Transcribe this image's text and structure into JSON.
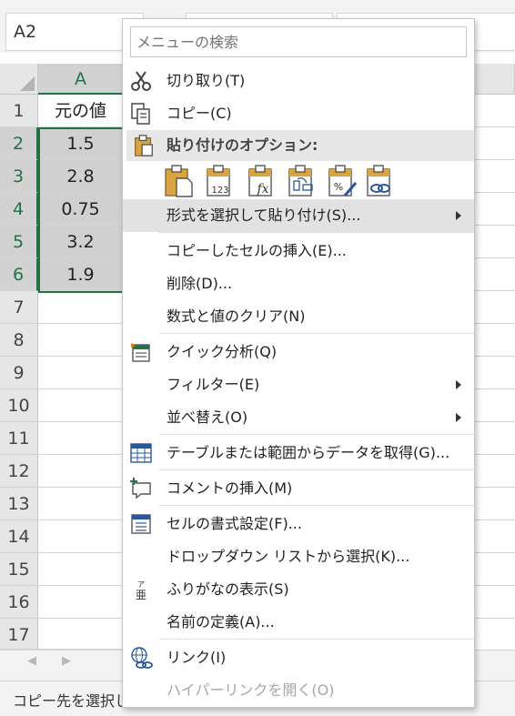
{
  "name_box": "A2",
  "columns": [
    "A"
  ],
  "rows": [
    "1",
    "2",
    "3",
    "4",
    "5",
    "6",
    "7",
    "8",
    "9",
    "10",
    "11",
    "12",
    "13",
    "14",
    "15",
    "16",
    "17"
  ],
  "cells": [
    "元の値",
    "1.5",
    "2.8",
    "0.75",
    "3.2",
    "1.9"
  ],
  "status_text": "コピー先を選択し",
  "menu": {
    "search_placeholder": "メニューの検索",
    "cut": "切り取り(T)",
    "copy": "コピー(C)",
    "paste_options": "貼り付けのオプション:",
    "paste_icons": [
      "paste-icon",
      "paste-values-icon",
      "paste-formulas-icon",
      "paste-transpose-icon",
      "paste-formatting-icon",
      "paste-link-icon"
    ],
    "paste_special": "形式を選択して貼り付け(S)...",
    "insert_copied": "コピーしたセルの挿入(E)...",
    "delete": "削除(D)...",
    "clear": "数式と値のクリア(N)",
    "quick_analysis": "クイック分析(Q)",
    "filter": "フィルター(E)",
    "sort": "並べ替え(O)",
    "get_data": "テーブルまたは範囲からデータを取得(G)...",
    "insert_comment": "コメントの挿入(M)",
    "format_cells": "セルの書式設定(F)...",
    "dropdown_pick": "ドロップダウン リストから選択(K)...",
    "show_furigana": "ふりがなの表示(S)",
    "define_name": "名前の定義(A)...",
    "link": "リンク(I)",
    "open_hyperlink": "ハイパーリンクを開く(O)"
  }
}
